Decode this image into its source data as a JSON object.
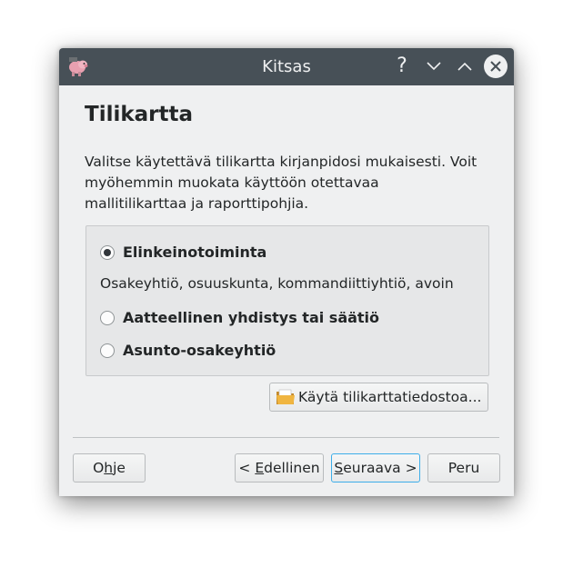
{
  "window": {
    "title": "Kitsas",
    "help_glyph": "?"
  },
  "page": {
    "heading": "Tilikartta",
    "description": "Valitse käytettävä tilikartta kirjanpidosi mukaisesti. Voit myöhemmin muokata käyttöön otettavaa mallitilikarttaa ja raporttipohjia."
  },
  "options": [
    {
      "label": "Elinkeinotoiminta",
      "selected": true,
      "description": "Osakeyhtiö, osuuskunta, kommandiittiyhtiö, avoin"
    },
    {
      "label": "Aatteellinen yhdistys tai säätiö",
      "selected": false
    },
    {
      "label": "Asunto-osakeyhtiö",
      "selected": false
    }
  ],
  "file_button": {
    "label": "Käytä tilikarttatiedostoa...",
    "icon": "folder-open-icon"
  },
  "footer": {
    "help": {
      "pre": "O",
      "mnemonic": "h",
      "post": "je"
    },
    "prev": {
      "pre": "< ",
      "mnemonic": "E",
      "post": "dellinen"
    },
    "next": {
      "pre": "",
      "mnemonic": "S",
      "post": "euraava >"
    },
    "cancel": {
      "pre": "",
      "mnemonic": "",
      "post": "Peru"
    }
  },
  "colors": {
    "titlebar": "#475057",
    "window_bg": "#eff0f1",
    "focus_accent": "#3daee9"
  }
}
